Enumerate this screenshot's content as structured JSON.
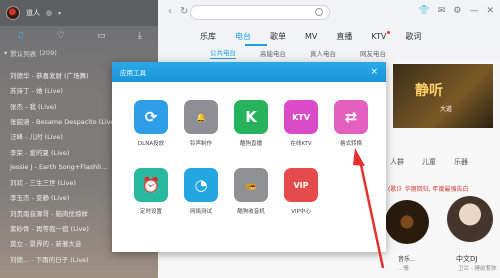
{
  "user": {
    "name": "道人"
  },
  "sidebar": {
    "toolbar_icons": [
      "music-note-icon",
      "heart-icon",
      "folder-icon",
      "download-icon"
    ],
    "list_header": "默认列表",
    "list_count": "(209)",
    "songs": [
      {
        "title": "刘德华 - 恭喜发财 (广场舞)",
        "mark": ""
      },
      {
        "title": "苏诗丁 - 她 (Live)",
        "mark": ""
      },
      {
        "title": "张杰 - 我 (Live)",
        "mark": ""
      },
      {
        "title": "张韶涵 - Besame Despacito (Live)",
        "mark": ""
      },
      {
        "title": "汪峰 - 儿时 (Live)",
        "mark": ""
      },
      {
        "title": "李荣 - 爱的夏 (Live)",
        "mark": ""
      },
      {
        "title": "Jessie J - Earth Song+Flashli...",
        "mark": "▤"
      },
      {
        "title": "刘欢 - 三生三世 (Live)",
        "mark": "▤"
      },
      {
        "title": "李玉杰 - 变静 (Live)",
        "mark": ""
      },
      {
        "title": "刘贵南音源哥 - 脑肉优惊样",
        "mark": "▤"
      },
      {
        "title": "紫砂骨 - 再等我一宿 (Live)",
        "mark": "▤"
      },
      {
        "title": "莫立 - 景界的 - 新兼大音",
        "mark": ""
      },
      {
        "title": "刘德... - 下雨的日子 (Live)",
        "mark": ""
      }
    ]
  },
  "nav": {
    "tabs": [
      {
        "label": "乐库",
        "active": false,
        "dot": false
      },
      {
        "label": "电台",
        "active": true,
        "dot": false
      },
      {
        "label": "歌单",
        "active": false,
        "dot": false
      },
      {
        "label": "MV",
        "active": false,
        "dot": false
      },
      {
        "label": "直播",
        "active": false,
        "dot": false
      },
      {
        "label": "KTV",
        "active": false,
        "dot": true
      },
      {
        "label": "歌词",
        "active": false,
        "dot": false
      }
    ],
    "subtabs": [
      {
        "label": "公共电台",
        "active": true
      },
      {
        "label": "高能电台",
        "active": false
      },
      {
        "label": "真人电台",
        "active": false
      },
      {
        "label": "网友电台",
        "active": false
      }
    ]
  },
  "banner": {
    "headline": "静听",
    "sub": "大道"
  },
  "categories": [
    "人群",
    "儿童",
    "乐器"
  ],
  "promo_text": "(歌)》华丽回归, 年度最强告白",
  "discs": [
    {
      "title": "音乐...",
      "sub": "...慢"
    },
    {
      "title": "中文DJ",
      "sub": "卫兰 - 睡前惹你"
    }
  ],
  "modal": {
    "title": "应用工具",
    "close": "×",
    "apps": [
      {
        "label": "DLNA投放",
        "icon": "dlna-icon",
        "color": "#2f9ee8"
      },
      {
        "label": "铃声制作",
        "icon": "ringtone-icon",
        "color": "#8d8f95"
      },
      {
        "label": "酷狗直播",
        "icon": "live-k-icon",
        "color": "#27b35c"
      },
      {
        "label": "在线KTV",
        "icon": "ktv-mic-icon",
        "color": "#d94bc7"
      },
      {
        "label": "格式转换",
        "icon": "format-convert-icon",
        "color": "#e35fc0"
      },
      {
        "label": "定时设置",
        "icon": "alarm-clock-icon",
        "color": "#28b8a0"
      },
      {
        "label": "网络测试",
        "icon": "speed-gauge-icon",
        "color": "#22a7e0"
      },
      {
        "label": "酷狗收音机",
        "icon": "radio-icon",
        "color": "#8e9094"
      },
      {
        "label": "VIP中心",
        "icon": "vip-icon",
        "color": "#e54b4b"
      }
    ]
  },
  "colors": {
    "accent": "#1ea0e0",
    "modal_header": "#1896d8",
    "annotation_arrow": "#e53030"
  }
}
